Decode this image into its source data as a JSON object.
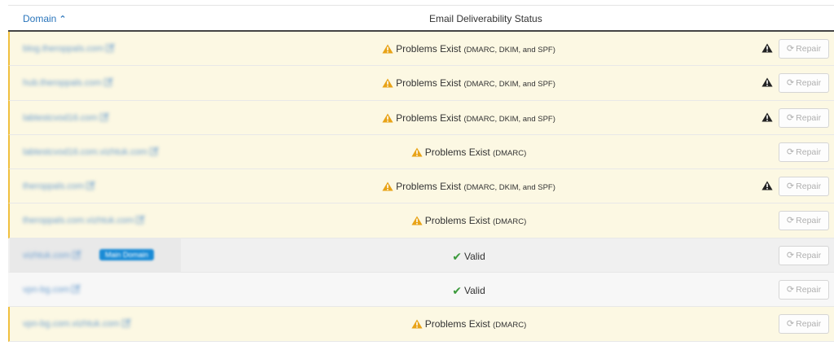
{
  "header": {
    "domain_label": "Domain",
    "status_label": "Email Deliverability Status"
  },
  "rows": [
    {
      "domain": "blog.theroppals.com",
      "status": "warn",
      "status_text": "Problems Exist",
      "detail": "(DMARC, DKIM, and SPF)",
      "alert": true,
      "repair_label": "Repair"
    },
    {
      "domain": "hub.theroppals.com",
      "status": "warn",
      "status_text": "Problems Exist",
      "detail": "(DMARC, DKIM, and SPF)",
      "alert": true,
      "repair_label": "Repair"
    },
    {
      "domain": "labtestcvod16.com",
      "status": "warn",
      "status_text": "Problems Exist",
      "detail": "(DMARC, DKIM, and SPF)",
      "alert": true,
      "repair_label": "Repair"
    },
    {
      "domain": "labtestcvod16.com.vizhtuk.com",
      "status": "warn",
      "status_text": "Problems Exist",
      "detail": "(DMARC)",
      "alert": false,
      "repair_label": "Repair"
    },
    {
      "domain": "theroppals.com",
      "status": "warn",
      "status_text": "Problems Exist",
      "detail": "(DMARC, DKIM, and SPF)",
      "alert": true,
      "repair_label": "Repair"
    },
    {
      "domain": "theroppals.com.vizhtuk.com",
      "status": "warn",
      "status_text": "Problems Exist",
      "detail": "(DMARC)",
      "alert": false,
      "repair_label": "Repair"
    },
    {
      "domain": "vizhtuk.com",
      "badge": "Main Domain",
      "status": "ok-main",
      "status_text": "Valid",
      "detail": "",
      "alert": false,
      "repair_label": "Repair"
    },
    {
      "domain": "vpn-bg.com",
      "status": "ok",
      "status_text": "Valid",
      "detail": "",
      "alert": false,
      "repair_label": "Repair"
    },
    {
      "domain": "vpn-bg.com.vizhtuk.com",
      "status": "warn",
      "status_text": "Problems Exist",
      "detail": "(DMARC)",
      "alert": false,
      "repair_label": "Repair"
    }
  ],
  "colors": {
    "link": "#2a75bb",
    "warning_bg": "#fcf8e3",
    "warning_icon": "#e8a317",
    "valid_check": "#3c9a3c",
    "badge_bg": "#1a8bd6"
  },
  "icons": {
    "sort": "chevron-up-icon",
    "edit": "external-edit-icon",
    "warning": "warning-triangle-icon",
    "valid": "check-icon",
    "alert": "alert-triangle-icon",
    "repair": "refresh-icon"
  }
}
